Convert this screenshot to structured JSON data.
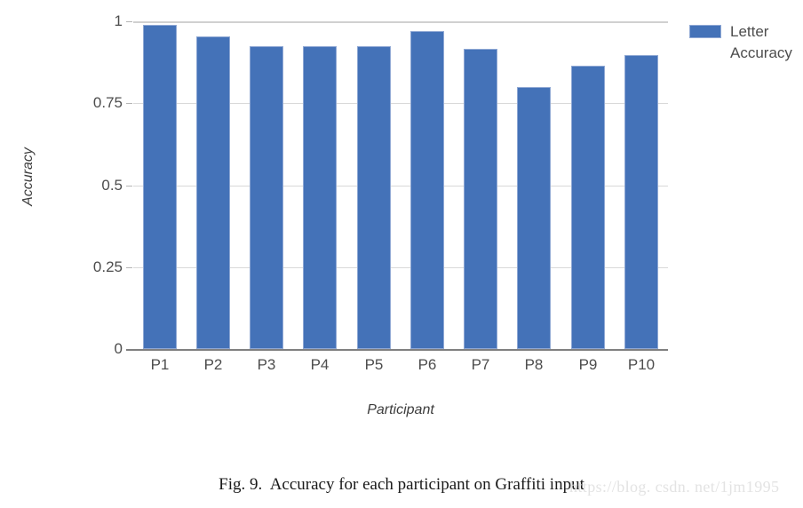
{
  "chart_data": {
    "type": "bar",
    "title": "",
    "xlabel": "Participant",
    "ylabel": "Accuracy",
    "categories": [
      "P1",
      "P2",
      "P3",
      "P4",
      "P5",
      "P6",
      "P7",
      "P8",
      "P9",
      "P10"
    ],
    "series": [
      {
        "name": "Letter Accuracy",
        "values": [
          0.99,
          0.955,
          0.925,
          0.925,
          0.925,
          0.97,
          0.915,
          0.8,
          0.865,
          0.897
        ]
      }
    ],
    "ylim": [
      0,
      1
    ],
    "yticks": [
      0,
      0.25,
      0.5,
      0.75,
      1
    ],
    "ytick_labels": [
      "0",
      "0.25",
      "0.5",
      "0.75",
      "1"
    ],
    "grid": true,
    "legend_position": "right",
    "bar_color": "#4472b8",
    "bar_border_color": "#8fa8d4",
    "gridline_color": "#d9d9d9",
    "axis_color": "#808080"
  },
  "legend": {
    "entries": [
      {
        "label_line1": "Letter",
        "label_line2": "Accuracy",
        "color": "#4472b8"
      }
    ]
  },
  "caption": {
    "text": "Fig. 9.  Accuracy for each participant on Graffiti input"
  },
  "watermark": {
    "text": "https://blog. csdn. net/1jm1995"
  }
}
